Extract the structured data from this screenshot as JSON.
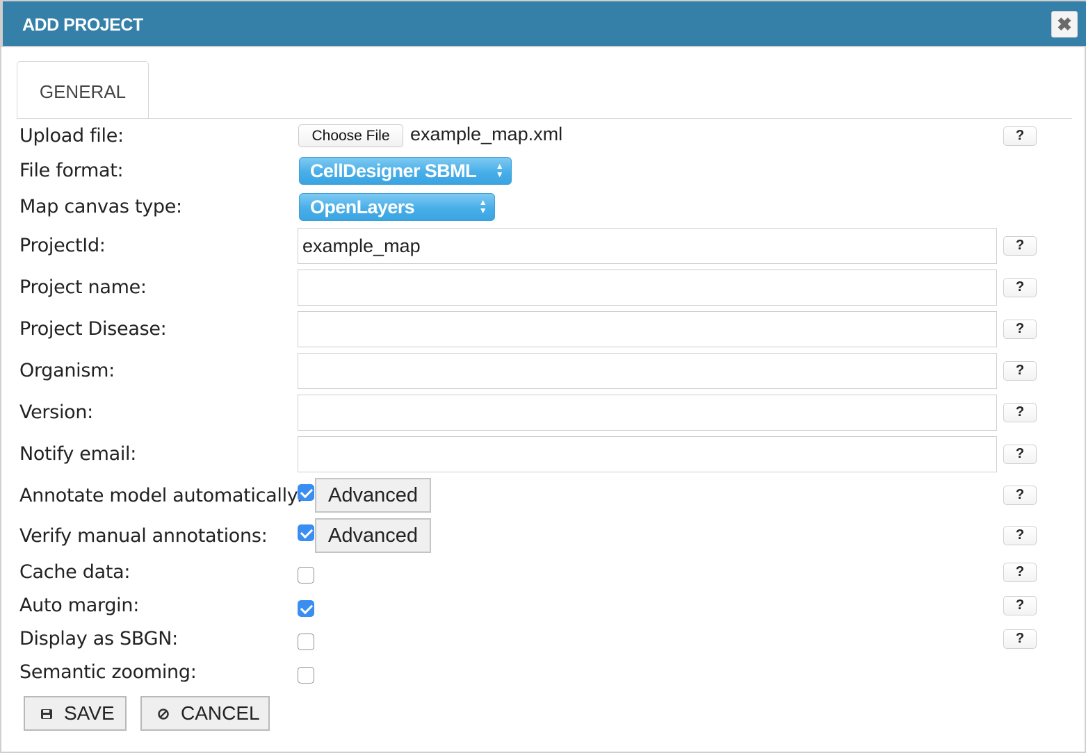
{
  "dialog": {
    "title": "ADD PROJECT",
    "close_icon": "close-x-icon"
  },
  "tabs": [
    {
      "label": "GENERAL",
      "active": true
    }
  ],
  "form": {
    "upload_file": {
      "label": "Upload file:",
      "button_label": "Choose File",
      "file_name": "example_map.xml"
    },
    "file_format": {
      "label": "File format:",
      "selected": "CellDesigner SBML"
    },
    "map_canvas_type": {
      "label": "Map canvas type:",
      "selected": "OpenLayers"
    },
    "project_id": {
      "label": "ProjectId:",
      "value": "example_map"
    },
    "project_name": {
      "label": "Project name:",
      "value": ""
    },
    "project_disease": {
      "label": "Project Disease:",
      "value": ""
    },
    "organism": {
      "label": "Organism:",
      "value": ""
    },
    "version": {
      "label": "Version:",
      "value": ""
    },
    "notify_email": {
      "label": "Notify email:",
      "value": ""
    },
    "annotate_model": {
      "label": "Annotate model automatically:",
      "checked": true,
      "advanced_label": "Advanced"
    },
    "verify_annotations": {
      "label": "Verify manual annotations:",
      "checked": true,
      "advanced_label": "Advanced"
    },
    "cache_data": {
      "label": "Cache data:",
      "checked": false
    },
    "auto_margin": {
      "label": "Auto margin:",
      "checked": true
    },
    "display_sbgn": {
      "label": "Display as SBGN:",
      "checked": false
    },
    "semantic_zooming": {
      "label": "Semantic zooming:",
      "checked": false
    },
    "help_label": "?"
  },
  "actions": {
    "save_label": "SAVE",
    "save_icon": "floppy-disk-icon",
    "cancel_label": "CANCEL",
    "cancel_icon": "ban-circle-icon"
  },
  "colors": {
    "titlebar": "#3480a8",
    "select_blue": "#48aee8",
    "checkbox_blue": "#3a8ef2"
  }
}
